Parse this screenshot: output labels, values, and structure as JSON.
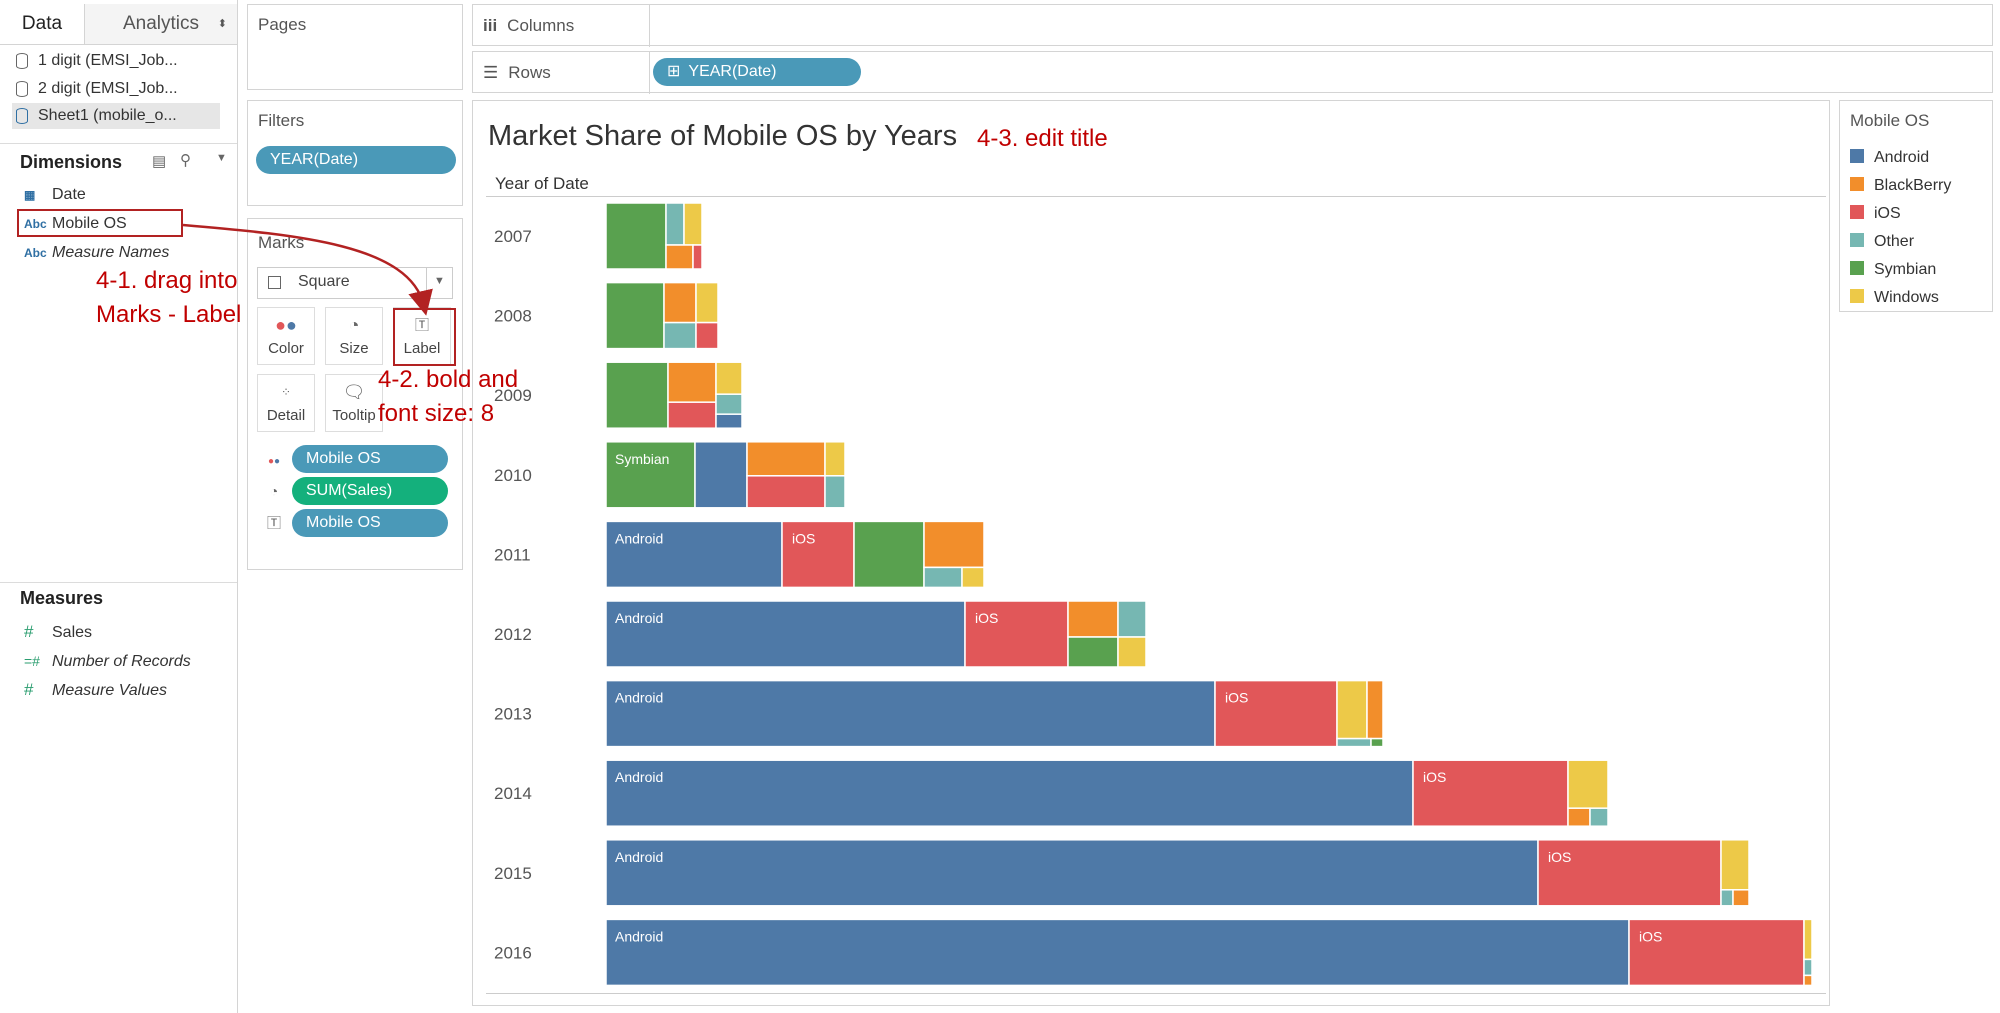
{
  "data_pane": {
    "tabs": [
      "Data",
      "Analytics"
    ],
    "datasources": [
      "1 digit (EMSI_Job...",
      "2 digit (EMSI_Job...",
      "Sheet1 (mobile_o..."
    ],
    "dimensions_header": "Dimensions",
    "dimensions": [
      {
        "type": "date",
        "label": "Date"
      },
      {
        "type": "Abc",
        "label": "Mobile OS"
      },
      {
        "type": "Abc",
        "label": "Measure Names"
      }
    ],
    "measures_header": "Measures",
    "measures": [
      {
        "type": "#",
        "label": "Sales"
      },
      {
        "type": "=#",
        "label": "Number of Records"
      },
      {
        "type": "#",
        "label": "Measure Values"
      }
    ]
  },
  "pages": {
    "title": "Pages"
  },
  "filters": {
    "title": "Filters",
    "pill": "YEAR(Date)"
  },
  "marks": {
    "title": "Marks",
    "mark_type": "Square",
    "buttons": [
      "Color",
      "Size",
      "Label",
      "Detail",
      "Tooltip"
    ],
    "pills": [
      "Mobile OS",
      "SUM(Sales)",
      "Mobile OS"
    ]
  },
  "shelves": {
    "columns_label": "Columns",
    "rows_label": "Rows",
    "rows_pill": "YEAR(Date)",
    "rows_pill_prefix": "⊞"
  },
  "viz": {
    "title": "Market Share of Mobile OS by Years",
    "row_header": "Year of Date"
  },
  "legend": {
    "title": "Mobile OS",
    "items": [
      {
        "label": "Android",
        "color": "#4e79a7"
      },
      {
        "label": "BlackBerry",
        "color": "#f28e2b"
      },
      {
        "label": "iOS",
        "color": "#e15759"
      },
      {
        "label": "Other",
        "color": "#76b7b2"
      },
      {
        "label": "Symbian",
        "color": "#59a14f"
      },
      {
        "label": "Windows",
        "color": "#edc948"
      }
    ]
  },
  "annotations": {
    "a41_line1": "4-1. drag into",
    "a41_line2": "Marks - Label",
    "a42_line1": "4-2. bold and",
    "a42_line2": "font size: 8",
    "a43": "4-3. edit title"
  },
  "chart_data": {
    "type": "treemap",
    "rows": [
      "2007",
      "2008",
      "2009",
      "2010",
      "2011",
      "2012",
      "2013",
      "2014",
      "2015",
      "2016"
    ],
    "labels": [
      "",
      "",
      "",
      "Symbian",
      "Android",
      "Android",
      "Android",
      "Android",
      "Android",
      "Android"
    ],
    "ios_labels": [
      "",
      "",
      "",
      "",
      "iOS",
      "iOS",
      "iOS",
      "iOS",
      "iOS",
      "iOS"
    ]
  }
}
